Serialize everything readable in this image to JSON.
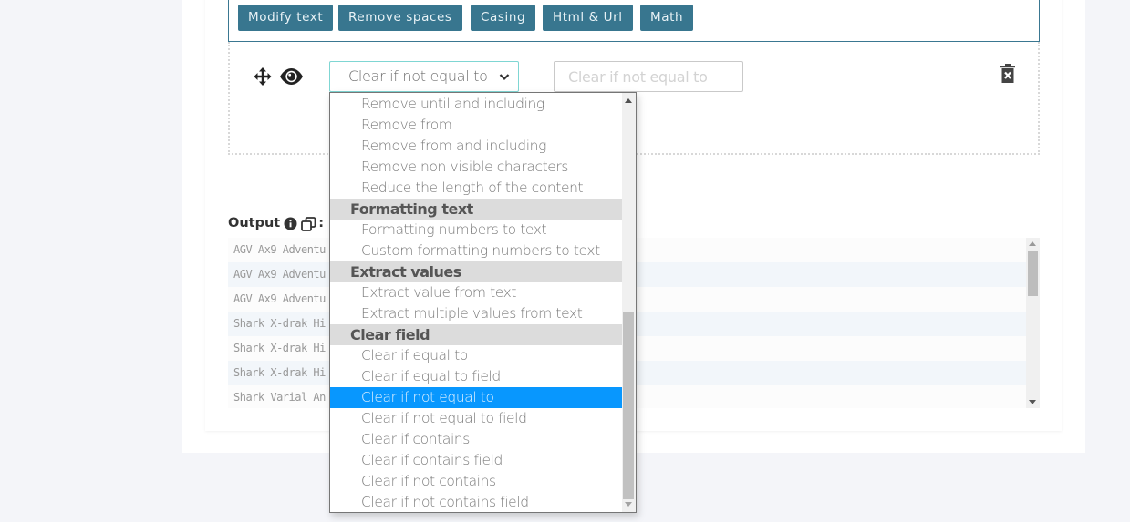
{
  "toolbar": {
    "buttons": [
      {
        "label": "Modify text"
      },
      {
        "label": "Remove spaces"
      },
      {
        "label": "Casing"
      },
      {
        "label": "Html & Url"
      },
      {
        "label": "Math"
      }
    ]
  },
  "rule": {
    "operation_selected": "Clear if not equal to",
    "value_placeholder": "Clear if not equal to",
    "value": ""
  },
  "dropdown": {
    "items": [
      {
        "type": "option",
        "label": "Remove until and including"
      },
      {
        "type": "option",
        "label": "Remove from"
      },
      {
        "type": "option",
        "label": "Remove from and including"
      },
      {
        "type": "option",
        "label": "Remove non visible characters"
      },
      {
        "type": "option",
        "label": "Reduce the length of the content"
      },
      {
        "type": "group",
        "label": "Formatting text"
      },
      {
        "type": "option",
        "label": "Formatting numbers to text"
      },
      {
        "type": "option",
        "label": "Custom formatting numbers to text"
      },
      {
        "type": "group",
        "label": "Extract values"
      },
      {
        "type": "option",
        "label": "Extract value from text"
      },
      {
        "type": "option",
        "label": "Extract multiple values from text"
      },
      {
        "type": "group",
        "label": "Clear field"
      },
      {
        "type": "option",
        "label": "Clear if equal to"
      },
      {
        "type": "option",
        "label": "Clear if equal to field"
      },
      {
        "type": "option",
        "label": "Clear if not equal to",
        "selected": true
      },
      {
        "type": "option",
        "label": "Clear if not equal to field"
      },
      {
        "type": "option",
        "label": "Clear if contains"
      },
      {
        "type": "option",
        "label": "Clear if contains field"
      },
      {
        "type": "option",
        "label": "Clear if not contains"
      },
      {
        "type": "option",
        "label": "Clear if not contains field"
      }
    ]
  },
  "output": {
    "label": "Output",
    "suffix": ":",
    "rows": [
      "AGV Ax9 Adventu",
      "AGV Ax9 Adventu",
      "AGV Ax9 Adventu",
      "Shark X-drak Hi",
      "Shark X-drak Hi",
      "Shark X-drak Hi",
      "Shark Varial An"
    ]
  },
  "colors": {
    "toolbar_button": "#38768f",
    "selected_option": "#0897fe",
    "select_border": "#7fd6d3",
    "page_background": "#f4f5f9"
  }
}
